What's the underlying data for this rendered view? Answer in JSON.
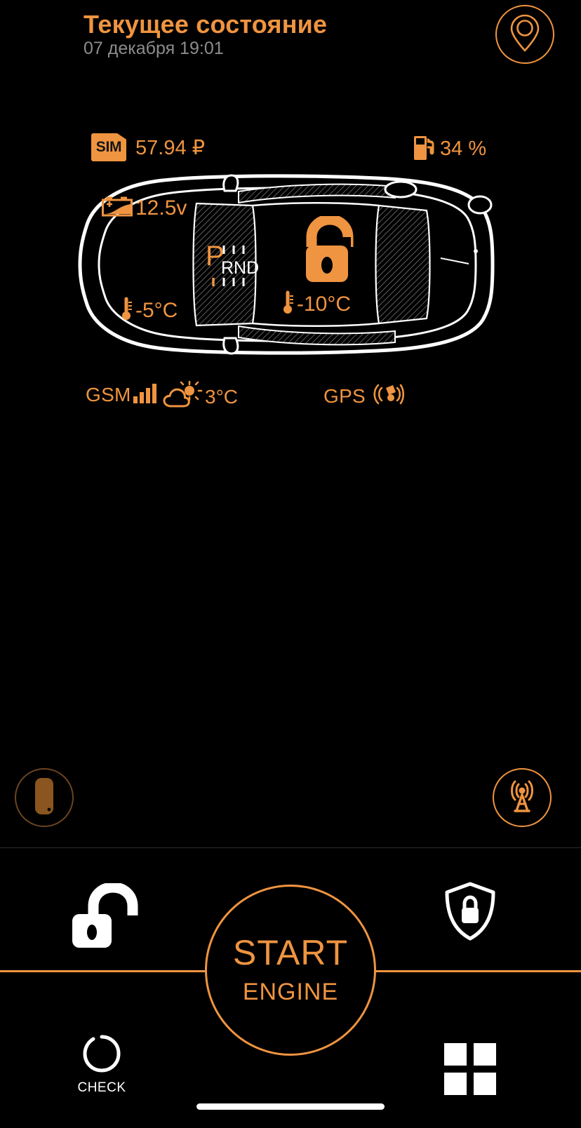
{
  "header": {
    "title": "Текущее состояние",
    "subtitle": "07 декабря 19:01",
    "location_icon": "map-pin-icon"
  },
  "status": {
    "sim_label": "SIM",
    "sim_balance": "57.94 ₽",
    "fuel_icon": "fuel-pump-icon",
    "fuel_level": "34 %"
  },
  "car": {
    "battery_icon": "car-battery-icon",
    "battery_voltage": "12.5v",
    "gear_selected": "P",
    "gear_others": "RND",
    "lock_icon": "padlock-open-icon",
    "engine_temp_icon": "thermometer-icon",
    "engine_temp": "-5°C",
    "cabin_temp_icon": "thermometer-icon",
    "cabin_temp": "-10°C"
  },
  "signals": {
    "gsm_label": "GSM",
    "gsm_icon": "signal-bars-icon",
    "gsm_bars": 4,
    "weather_icon": "cloud-sun-icon",
    "weather_temp": "3°C",
    "gps_label": "GPS",
    "gps_icon": "satellite-icon"
  },
  "float_buttons": {
    "key_fob_icon": "key-fob-icon",
    "radio_icon": "radio-tower-icon"
  },
  "controls": {
    "unlock_icon": "padlock-open-icon",
    "shield_icon": "shield-lock-icon",
    "check_icon": "check-circle-icon",
    "check_label": "CHECK",
    "grid_icon": "grid-four-squares-icon",
    "start_main": "START",
    "start_sub": "ENGINE"
  },
  "colors": {
    "accent": "#ef9440",
    "background": "#000000",
    "muted_text": "#8c8c8c",
    "white": "#ffffff",
    "dim_accent": "#6b4420"
  }
}
